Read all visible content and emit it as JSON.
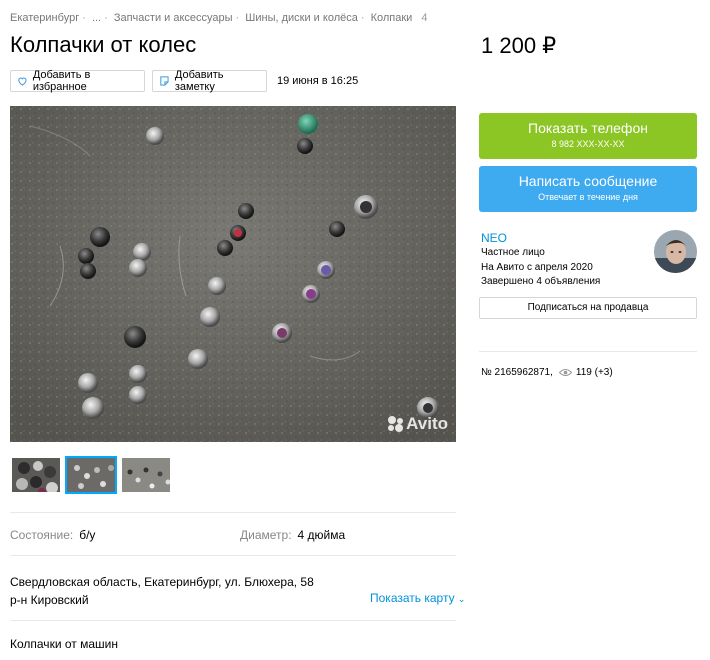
{
  "breadcrumbs": {
    "items": [
      "Екатеринбург",
      "...",
      "Запчасти и аксессуары",
      "Шины, диски и колёса",
      "Колпаки"
    ],
    "count": "4"
  },
  "listing": {
    "title": "Колпачки от колес",
    "price": "1 200 ₽",
    "date": "19 июня в 16:25",
    "favorite_label": "Добавить в избранное",
    "note_label": "Добавить заметку",
    "watermark": "Avito"
  },
  "params": {
    "condition_label": "Состояние:",
    "condition_value": "б/у",
    "diameter_label": "Диаметр:",
    "diameter_value": "4 дюйма"
  },
  "location": {
    "address": "Свердловская область, Екатеринбург, ул. Блюхера, 58",
    "district": "р-н Кировский",
    "map_link": "Показать карту"
  },
  "description": "Колпачки от машин",
  "contact": {
    "phone_label": "Показать телефон",
    "phone_masked": "8 982 XXX-XX-XX",
    "message_label": "Написать сообщение",
    "message_sub": "Отвечает в течение дня"
  },
  "seller": {
    "name": "NEO",
    "type": "Частное лицо",
    "since": "На Авито с апреля 2020",
    "completed": "Завершено 4 объявления",
    "subscribe_label": "Подписаться на продавца"
  },
  "stats": {
    "item_number": "№ 2165962871,",
    "views": "119 (+3)"
  },
  "colors": {
    "accent_link": "#0091d9",
    "phone_button": "#8bc624",
    "message_button": "#3eaaf0"
  }
}
